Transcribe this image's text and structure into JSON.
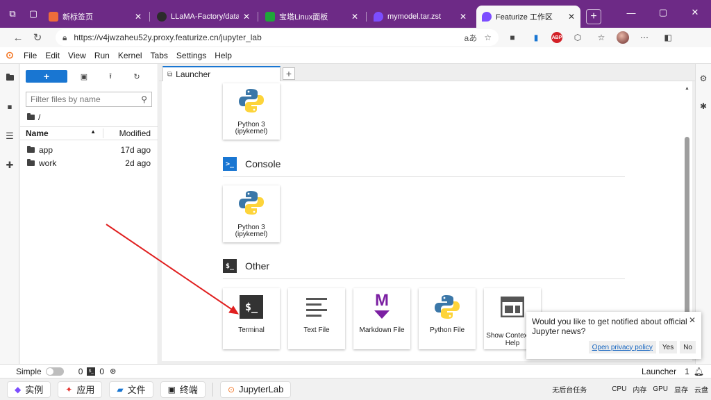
{
  "browser": {
    "tabs": [
      {
        "title": "新标签页",
        "favicon_color": "#ef6c3a",
        "active": false
      },
      {
        "title": "LLaMA-Factory/data/REA",
        "favicon_color": "#2b2b2b",
        "active": false
      },
      {
        "title": "宝塔Linux面板",
        "favicon_color": "#20a53a",
        "active": false
      },
      {
        "title": "mymodel.tar.zst",
        "favicon_color": "#7c4dff",
        "active": false
      },
      {
        "title": "Featurize 工作区",
        "favicon_color": "#7c4dff",
        "active": true
      }
    ],
    "url": "https://v4jwzaheu52y.proxy.featurize.cn/jupyter_lab",
    "read_aloud": "aあ",
    "abp_label": "ABP",
    "accent": "#6d2a86"
  },
  "menu": [
    "File",
    "Edit",
    "View",
    "Run",
    "Kernel",
    "Tabs",
    "Settings",
    "Help"
  ],
  "filebrowser": {
    "new_label": "+",
    "filter_placeholder": "Filter files by name",
    "path": "/",
    "col_name": "Name",
    "col_modified": "Modified",
    "rows": [
      {
        "name": "app",
        "modified": "17d ago"
      },
      {
        "name": "work",
        "modified": "2d ago"
      }
    ]
  },
  "doc_tab": {
    "title": "Launcher",
    "add": "+"
  },
  "launcher": {
    "notebook_card": {
      "line1": "Python 3",
      "line2": "(ipykernel)"
    },
    "console": {
      "title": "Console",
      "icon_text": ">_",
      "card_line1": "Python 3",
      "card_line2": "(ipykernel)"
    },
    "other": {
      "title": "Other",
      "icon_text": "$_",
      "cards": [
        {
          "label": "Terminal",
          "icon_text": "$_"
        },
        {
          "label": "Text File"
        },
        {
          "label": "Markdown File",
          "icon_text": "M"
        },
        {
          "label": "Python File"
        },
        {
          "label": "Show Contextual Help"
        }
      ]
    }
  },
  "toast": {
    "message": "Would you like to get notified about official Jupyter news?",
    "link": "Open privacy policy",
    "yes": "Yes",
    "no": "No"
  },
  "statusbar": {
    "simple": "Simple",
    "count1": "0",
    "term_icon": "$_",
    "count2": "0",
    "mode": "Launcher",
    "notifications": "1"
  },
  "taskbar": {
    "items": [
      "实例",
      "应用",
      "文件",
      "终端",
      "JupyterLab"
    ],
    "right": [
      "无后台任务",
      "CPU",
      "内存",
      "GPU",
      "显存",
      "云盘"
    ]
  }
}
